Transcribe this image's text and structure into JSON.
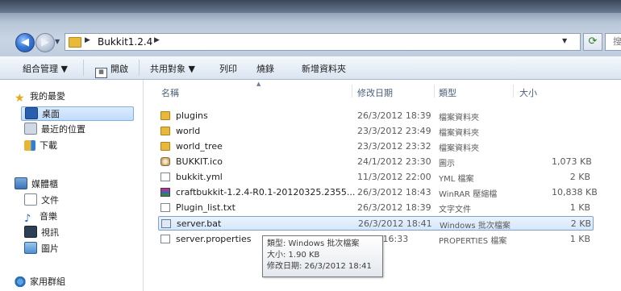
{
  "address_bar": {
    "path": [
      "Bukkit1.2.4"
    ],
    "search_placeholder": "搜"
  },
  "toolbar": {
    "organize": "組合管理 ▼",
    "open": "開啟",
    "share": "共用對象 ▼",
    "print": "列印",
    "burn": "燒錄",
    "new_folder": "新增資料夾"
  },
  "nav": {
    "favorites": {
      "label": "我的最愛",
      "items": [
        {
          "label": "桌面"
        },
        {
          "label": "最近的位置"
        },
        {
          "label": "下載"
        }
      ]
    },
    "libraries": {
      "label": "媒體櫃",
      "items": [
        {
          "label": "文件"
        },
        {
          "label": "音樂"
        },
        {
          "label": "視訊"
        },
        {
          "label": "圖片"
        }
      ]
    },
    "homegroup": {
      "label": "家用群組"
    }
  },
  "columns": {
    "name": "名稱",
    "date": "修改日期",
    "type": "類型",
    "size": "大小"
  },
  "files": [
    {
      "name": "plugins",
      "date": "26/3/2012 18:39",
      "type": "檔案資料夾",
      "size": "",
      "icon": "folder-icon"
    },
    {
      "name": "world",
      "date": "23/3/2012 23:49",
      "type": "檔案資料夾",
      "size": "",
      "icon": "folder-icon"
    },
    {
      "name": "world_tree",
      "date": "23/3/2012 23:32",
      "type": "檔案資料夾",
      "size": "",
      "icon": "folder-icon"
    },
    {
      "name": "BUKKIT.ico",
      "date": "24/1/2012 23:30",
      "type": "圖示",
      "size": "1,073 KB",
      "icon": "ico-file-icon"
    },
    {
      "name": "bukkit.yml",
      "date": "11/3/2012 22:00",
      "type": "YML 檔案",
      "size": "2 KB",
      "icon": "document-icon"
    },
    {
      "name": "craftbukkit-1.2.4-R0.1-20120325.2355...",
      "date": "26/3/2012 18:43",
      "type": "WinRAR 壓縮檔",
      "size": "10,838 KB",
      "icon": "winrar-icon"
    },
    {
      "name": "Plugin_list.txt",
      "date": "26/3/2012 18:39",
      "type": "文字文件",
      "size": "1 KB",
      "icon": "text-file-icon"
    },
    {
      "name": "server.bat",
      "date": "26/3/2012 18:41",
      "type": "Windows 批次檔案",
      "size": "2 KB",
      "icon": "batch-file-icon",
      "selected": true
    },
    {
      "name": "server.properties",
      "date": "2012 16:33",
      "type": "PROPERTIES 檔案",
      "size": "1 KB",
      "icon": "document-icon"
    }
  ],
  "tooltip": {
    "type": "類型: Windows 批次檔案",
    "size": "大小: 1.90 KB",
    "modified": "修改日期: 26/3/2012 18:41"
  }
}
